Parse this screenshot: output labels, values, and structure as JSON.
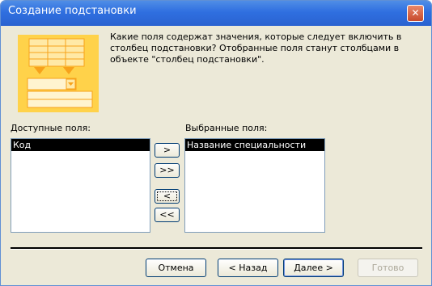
{
  "window": {
    "title": "Создание подстановки",
    "close_glyph": "✕"
  },
  "description": "Какие поля содержат значения, которые следует включить в столбец подстановки? Отобранные поля станут столбцами в объекте \"столбец подстановки\".",
  "available": {
    "label": "Доступные поля:",
    "items": [
      "Код"
    ]
  },
  "selected": {
    "label": "Выбранные поля:",
    "items": [
      "Название специальности"
    ]
  },
  "move_buttons": {
    "add_one": ">",
    "add_all": ">>",
    "remove_one": "<",
    "remove_all": "<<"
  },
  "footer": {
    "cancel": "Отмена",
    "back": "< Назад",
    "next": "Далее >",
    "finish": "Готово"
  },
  "colors": {
    "accent": "#2f6fe0",
    "illustration": "#ffd24a",
    "selection": "#000000"
  }
}
